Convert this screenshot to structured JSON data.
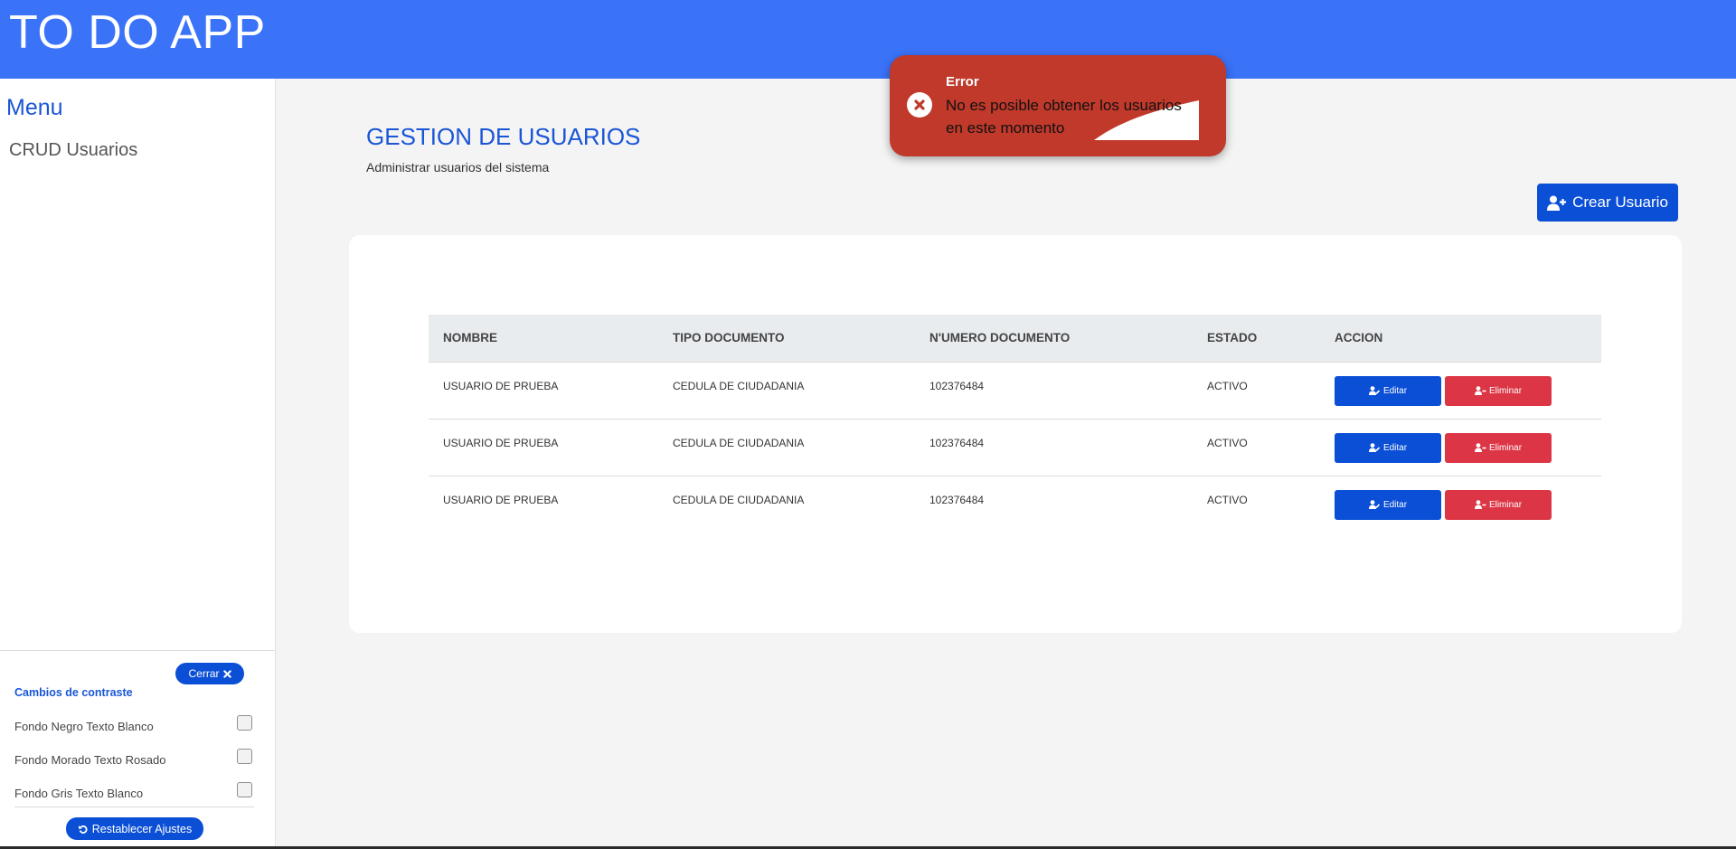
{
  "header": {
    "title": "TO DO APP"
  },
  "sidebar": {
    "menu_title": "Menu",
    "items": [
      {
        "label": "CRUD Usuarios"
      }
    ]
  },
  "accessibility": {
    "close_label": "Cerrar",
    "section_title": "Cambios de contraste",
    "options": [
      {
        "label": "Fondo Negro Texto Blanco",
        "checked": false
      },
      {
        "label": "Fondo Morado Texto Rosado",
        "checked": false
      },
      {
        "label": "Fondo Gris Texto Blanco",
        "checked": false
      }
    ],
    "reset_label": "Restablecer Ajustes"
  },
  "main": {
    "title": "GESTION DE USUARIOS",
    "subtitle": "Administrar usuarios del sistema",
    "create_button": "Crear Usuario"
  },
  "table": {
    "columns": [
      "NOMBRE",
      "TIPO DOCUMENTO",
      "N'UMERO DOCUMENTO",
      "ESTADO",
      "ACCION"
    ],
    "rows": [
      {
        "nombre": "USUARIO DE PRUEBA",
        "tipo": "CEDULA DE CIUDADANIA",
        "numero": "102376484",
        "estado": "ACTIVO"
      },
      {
        "nombre": "USUARIO DE PRUEBA",
        "tipo": "CEDULA DE CIUDADANIA",
        "numero": "102376484",
        "estado": "ACTIVO"
      },
      {
        "nombre": "USUARIO DE PRUEBA",
        "tipo": "CEDULA DE CIUDADANIA",
        "numero": "102376484",
        "estado": "ACTIVO"
      }
    ],
    "edit_label": "Editar",
    "delete_label": "Eliminar"
  },
  "toast": {
    "title": "Error",
    "message": "No es posible obtener los usuarios en este momento",
    "icon": "error-x-circle-icon"
  },
  "colors": {
    "header": "#3a72f8",
    "primary": "#0b4fd6",
    "danger": "#dc3545",
    "toast": "#c0392b",
    "accent_text": "#1a56d6"
  }
}
